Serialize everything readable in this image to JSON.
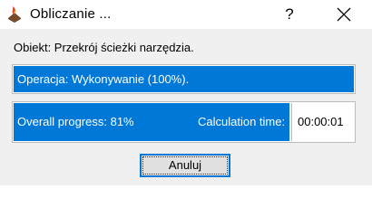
{
  "window": {
    "title": "Obliczanie ...",
    "help_label": "?"
  },
  "object_label": "Obiekt: Przekrój ścieżki narzędzia.",
  "operation": {
    "text": "Operacja: Wykonywanie (100%).",
    "progress": 1.0
  },
  "overall": {
    "text": "Overall progress: 81%",
    "progress": 0.81,
    "calc_label": "Calculation time:",
    "time": "00:00:01"
  },
  "cancel_label": "Anuluj",
  "colors": {
    "progress_fill": "#0078d7",
    "focus_border": "#0078d7"
  }
}
